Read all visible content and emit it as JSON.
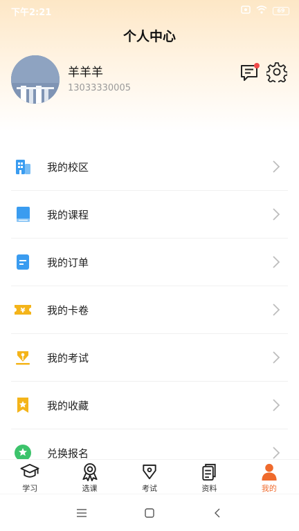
{
  "status": {
    "time": "下午2:21",
    "battery": "69"
  },
  "header": {
    "title": "个人中心"
  },
  "profile": {
    "name": "羊羊羊",
    "phone": "13033330005"
  },
  "menu": {
    "items": [
      {
        "label": "我的校区",
        "icon": "building-icon"
      },
      {
        "label": "我的课程",
        "icon": "book-icon"
      },
      {
        "label": "我的订单",
        "icon": "document-icon"
      },
      {
        "label": "我的卡卷",
        "icon": "ticket-icon"
      },
      {
        "label": "我的考试",
        "icon": "pen-icon"
      },
      {
        "label": "我的收藏",
        "icon": "bookmark-icon"
      },
      {
        "label": "兑换报名",
        "icon": "badge-icon"
      }
    ]
  },
  "tabbar": {
    "items": [
      {
        "label": "学习",
        "icon": "graduation-cap-icon"
      },
      {
        "label": "选课",
        "icon": "medal-icon"
      },
      {
        "label": "考试",
        "icon": "pen-nib-icon"
      },
      {
        "label": "资料",
        "icon": "files-icon"
      },
      {
        "label": "我的",
        "icon": "person-icon"
      }
    ],
    "active": "我的"
  },
  "colors": {
    "accent": "#ef6a2c",
    "blue": "#3a9cf0",
    "yellow": "#f4b41a",
    "green": "#3cc36b",
    "notification": "#f04a4a"
  }
}
